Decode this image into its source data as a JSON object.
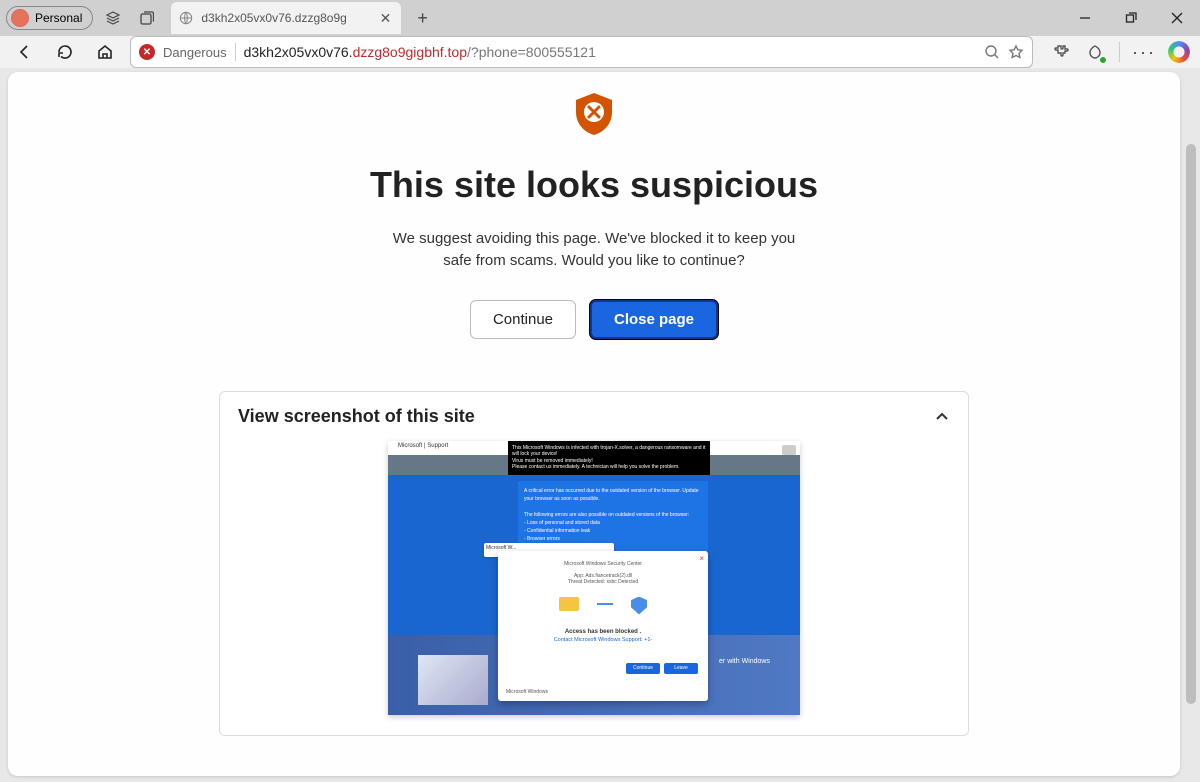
{
  "profile": {
    "label": "Personal"
  },
  "tab": {
    "title": "d3kh2x05vx0v76.dzzg8o9g"
  },
  "address": {
    "danger_label": "Dangerous",
    "url_prefix": "d3kh2x05vx0v76.",
    "url_host": "dzzg8o9gigbhf.top",
    "url_path": "/?phone=800555121"
  },
  "warning": {
    "heading": "This site looks suspicious",
    "subtext": "We suggest avoiding this page. We've blocked it to keep you safe from scams. Would you like to continue?",
    "continue_label": "Continue",
    "close_label": "Close page"
  },
  "card": {
    "title": "View screenshot of this site"
  },
  "screenshot": {
    "brand": "Microsoft | Support",
    "banner_l1": "This Microsoft Windows is infected with trojan-X.solver, a dangerous ransomware and it will lock your device!",
    "banner_l2": "Virus must be removed immediately!",
    "banner_l3": "Please contact us immediately. A technician will help you solve the problem.",
    "bluebox_l1": "A critical error has occurred due to the outdated version of the browser. Update your browser as soon as possible.",
    "bluebox_l2": "The following errors are also possible on outdated versions of the browser:",
    "bluebox_l3": "- Loss of personal and stored data",
    "bluebox_l4": "- Confidential information leak",
    "bluebox_l5": "- Browser errors",
    "win_small": "Microsoft W...",
    "win_title_l1": "Microsoft Windows Security Center",
    "win_title_l2": "App: Ads.fiancetrack(2).dll",
    "win_title_l3": "Threat Detected: xxbc Detected",
    "access": "Access has been blocked .",
    "support": "Contact Microsoft Windows Support: +1-",
    "btn1": "Continue",
    "btn2": "Leave",
    "footer": "Microsoft Windows",
    "right": "er with Windows"
  }
}
